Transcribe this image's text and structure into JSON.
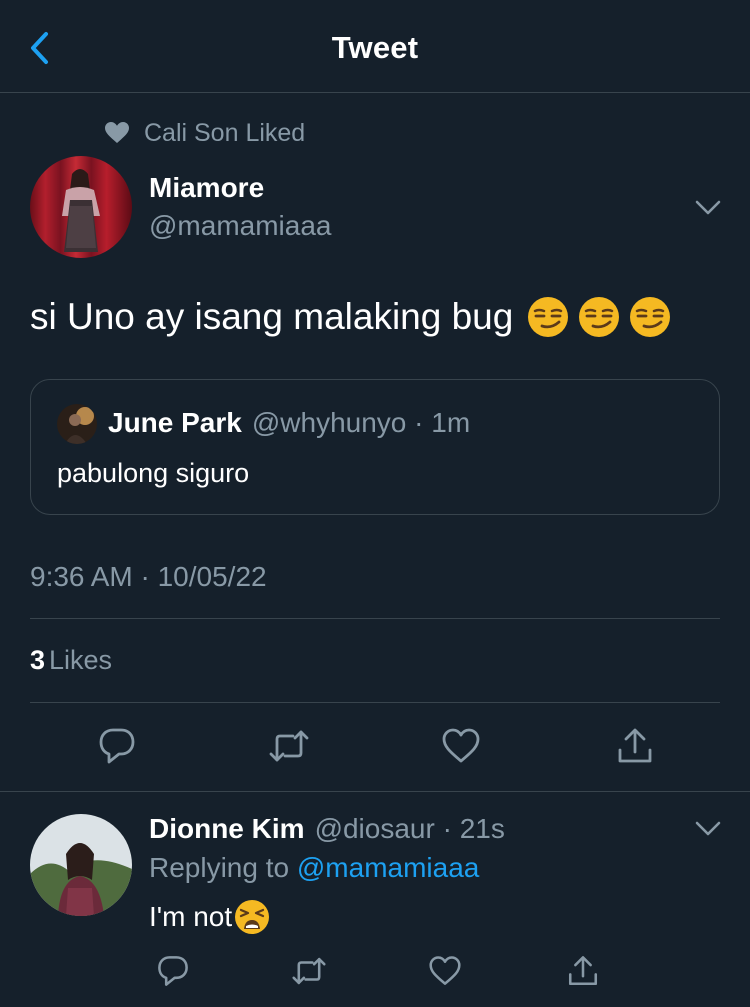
{
  "header": {
    "title": "Tweet"
  },
  "social_context": {
    "text": "Cali Son Liked"
  },
  "tweet": {
    "author_name": "Miamore",
    "author_handle": "@mamamiaaa",
    "text": "si Uno ay isang malaking bug",
    "emojis": [
      "smirking-face",
      "smirking-face",
      "smirking-face"
    ],
    "timestamp": "9:36 AM · 10/05/22",
    "likes_count": "3",
    "likes_label": "Likes"
  },
  "quote": {
    "name": "June Park",
    "meta": "@whyhunyo · 1m",
    "text": "pabulong siguro"
  },
  "reply": {
    "name": "Dionne Kim",
    "meta": "@diosaur · 21s",
    "replying_prefix": "Replying to",
    "replying_mention": "@mamamiaaa",
    "text": "I'm not",
    "emoji": "tired-face"
  },
  "colors": {
    "background": "#15202b",
    "text": "#ffffff",
    "secondary": "#8899a6",
    "accent": "#1da1f2",
    "divider": "#38444d"
  },
  "icons": [
    "back-chevron",
    "heart",
    "chevron-down",
    "reply",
    "retweet",
    "like",
    "share"
  ]
}
